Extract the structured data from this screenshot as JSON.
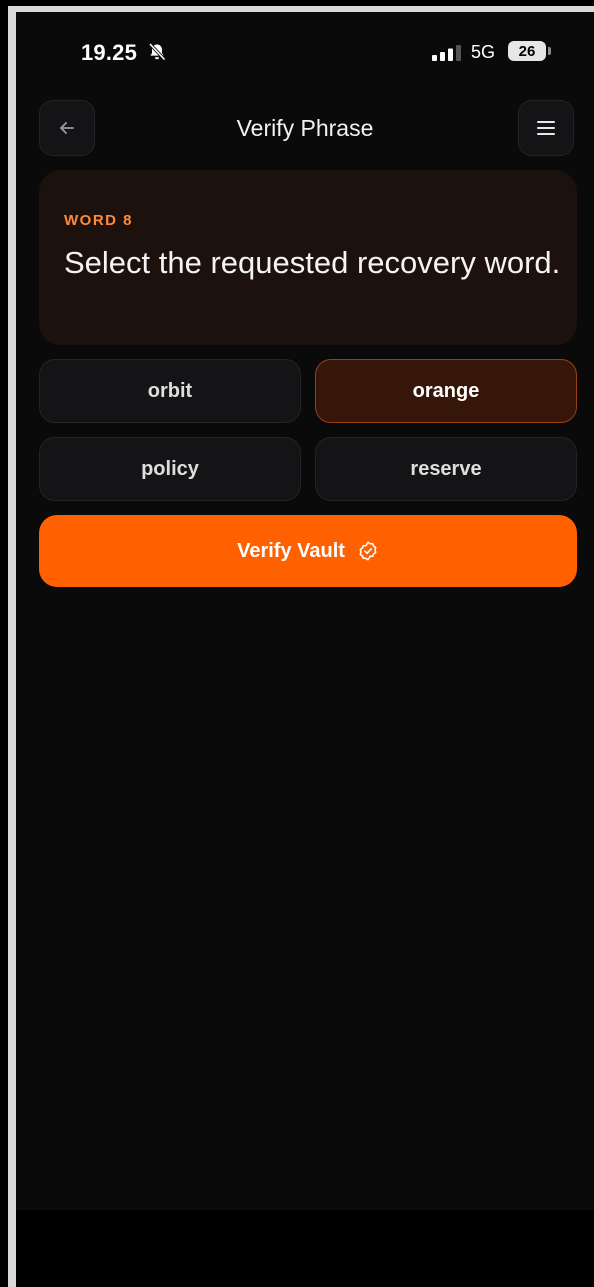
{
  "status_bar": {
    "time": "19.25",
    "network": "5G",
    "battery": "26"
  },
  "header": {
    "title": "Verify Phrase",
    "back_icon": "arrow-left-icon",
    "menu_icon": "hamburger-menu-icon"
  },
  "prompt": {
    "word_label": "WORD 8",
    "instruction": "Select the requested recovery word."
  },
  "options": [
    {
      "label": "orbit",
      "selected": false
    },
    {
      "label": "orange",
      "selected": true
    },
    {
      "label": "policy",
      "selected": false
    },
    {
      "label": "reserve",
      "selected": false
    }
  ],
  "verify_button": {
    "label": "Verify Vault",
    "icon": "check-badge-icon"
  },
  "colors": {
    "accent": "#ff6000",
    "word_label": "#ff8a3c",
    "selected_bg": "#361608",
    "card_bg": "#1c110d",
    "background": "#0a0a0b"
  }
}
